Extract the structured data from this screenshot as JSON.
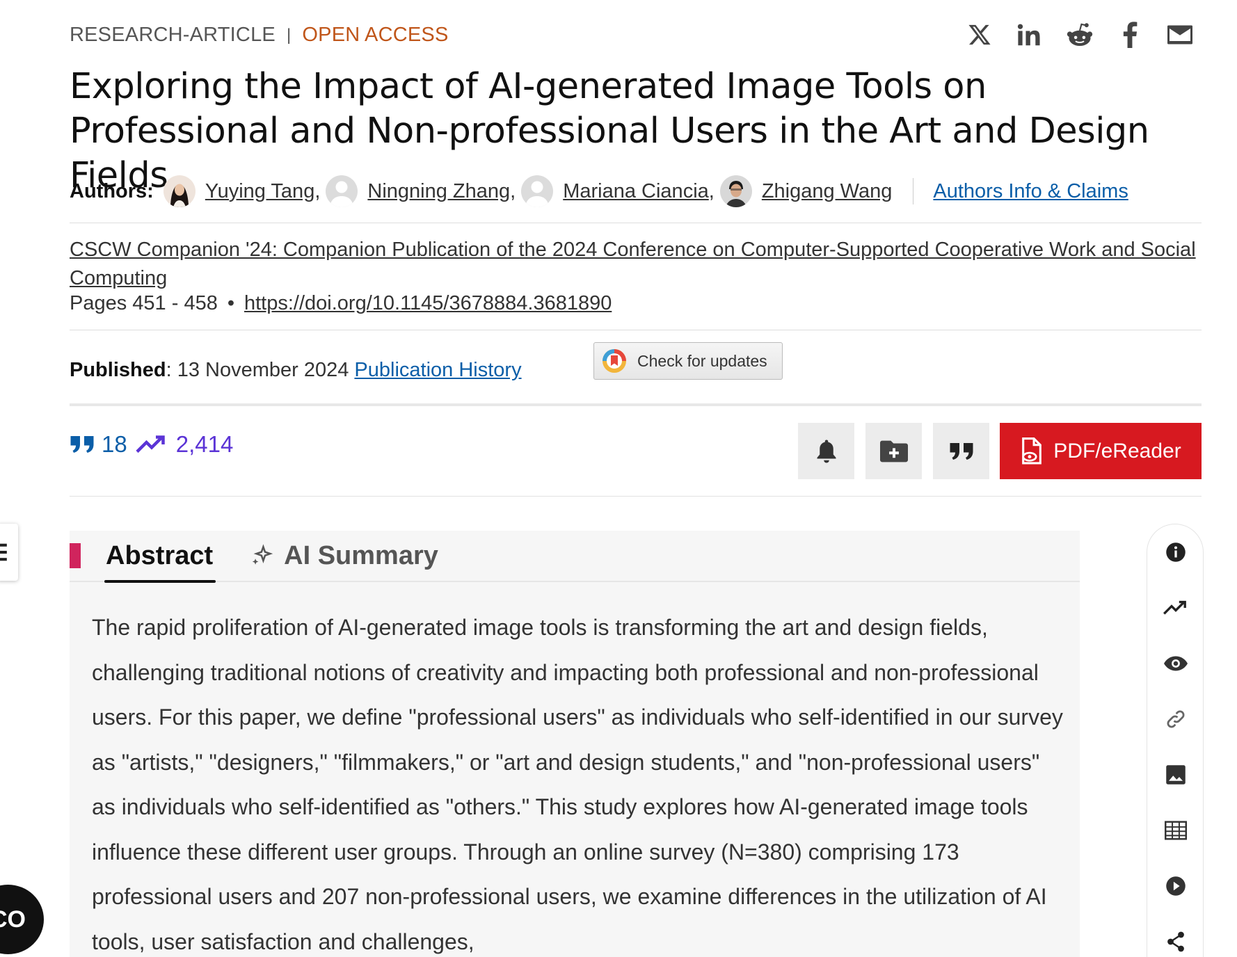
{
  "header": {
    "article_type": "RESEARCH-ARTICLE",
    "access": "OPEN ACCESS",
    "share_icons": [
      "x-icon",
      "linkedin-icon",
      "reddit-icon",
      "facebook-icon",
      "email-icon"
    ]
  },
  "title": "Exploring the Impact of AI-generated Image Tools on Professional and Non-professional Users in the Art and Design Fields",
  "authors": {
    "label": "Authors:",
    "list": [
      {
        "name": "Yuying Tang",
        "sep": ","
      },
      {
        "name": "Ningning Zhang",
        "sep": ","
      },
      {
        "name": "Mariana Ciancia",
        "sep": ","
      },
      {
        "name": "Zhigang Wang",
        "sep": ""
      }
    ],
    "info_link": "Authors Info & Claims"
  },
  "publication": {
    "venue": "CSCW Companion '24: Companion Publication of the 2024 Conference on Computer-Supported Cooperative Work and Social Computing",
    "pages": "Pages 451 - 458",
    "bullet": "•",
    "doi": "https://doi.org/10.1145/3678884.3681890",
    "published_label": "Published",
    "published_date": ": 13 November 2024",
    "history_link": "Publication History",
    "check_updates": "Check for updates"
  },
  "metrics": {
    "citations": "18",
    "downloads": "2,414"
  },
  "actions": {
    "pdf_label": "PDF/eReader"
  },
  "tabs": {
    "abstract": "Abstract",
    "ai_summary": "AI Summary"
  },
  "abstract_text": "The rapid proliferation of AI-generated image tools is transforming the art and design fields, challenging traditional notions of creativity and impacting both professional and non-professional users. For this paper, we define \"professional users\" as individuals who self-identified in our survey as \"artists,\" \"designers,\" \"filmmakers,\" or \"art and design students,\" and \"non-professional users\" as individuals who self-identified as \"others.\" This study explores how AI-generated image tools influence these different user groups. Through an online survey (N=380) comprising 173 professional users and 207 non-professional users, we examine differences in the utilization of AI tools, user satisfaction and challenges,",
  "floating": {
    "bubble_text": "CO"
  },
  "colors": {
    "open_access": "#c0561a",
    "link": "#0b5ea8",
    "downloads": "#5b34d6",
    "pdf_button": "#d71920",
    "tab_marker": "#d0245d"
  }
}
